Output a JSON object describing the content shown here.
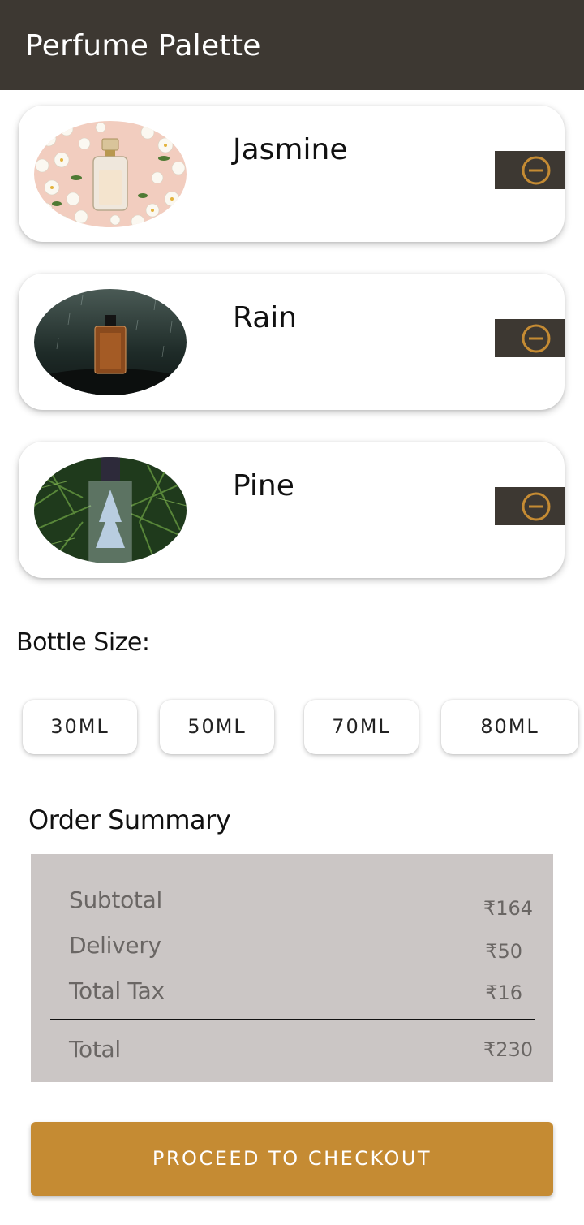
{
  "app_bar": {
    "title": "Perfume Palette"
  },
  "cart": {
    "items": [
      {
        "name": "Jasmine",
        "image": "jasmine-perfume-image",
        "remove_icon": "minus-circle-icon"
      },
      {
        "name": "Rain",
        "image": "rain-perfume-image",
        "remove_icon": "minus-circle-icon"
      },
      {
        "name": "Pine",
        "image": "pine-perfume-image",
        "remove_icon": "minus-circle-icon"
      }
    ]
  },
  "bottle_size": {
    "label": "Bottle Size:",
    "options": [
      "30ML",
      "50ML",
      "70ML",
      "80ML"
    ]
  },
  "order_summary": {
    "title": "Order Summary",
    "rows": [
      {
        "label": "Subtotal",
        "value": "₹164"
      },
      {
        "label": "Delivery",
        "value": "₹50"
      },
      {
        "label": "Total Tax",
        "value": "₹16"
      }
    ],
    "total": {
      "label": "Total",
      "value": "₹230"
    }
  },
  "checkout": {
    "label": "PROCEED TO CHECKOUT"
  },
  "colors": {
    "app_bar": "#3d3832",
    "accent": "#c58b33",
    "summary_bg": "#cbc6c5",
    "summary_text": "#6a6664"
  }
}
